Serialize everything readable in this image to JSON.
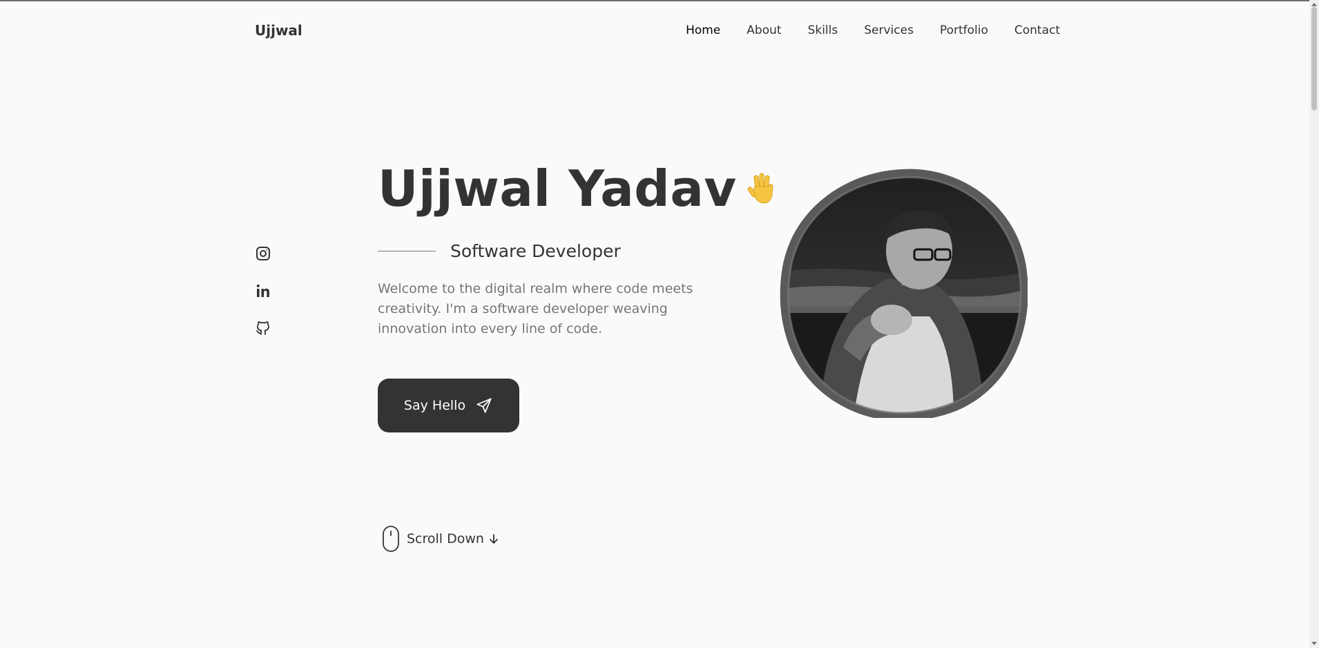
{
  "header": {
    "logo": "Ujjwal",
    "nav": [
      {
        "label": "Home",
        "active": true
      },
      {
        "label": "About"
      },
      {
        "label": "Skills"
      },
      {
        "label": "Services"
      },
      {
        "label": "Portfolio"
      },
      {
        "label": "Contact"
      }
    ]
  },
  "social": [
    "instagram-icon",
    "linkedin-icon",
    "github-icon"
  ],
  "hero": {
    "name": "Ujjwal Yadav",
    "wave_icon": "waving-hand-icon",
    "subtitle": "Software Developer",
    "description": "Welcome to the digital realm where code meets creativity. I'm a software developer weaving innovation into every line of code.",
    "cta_label": "Say Hello",
    "cta_icon": "send-icon",
    "scroll_label": "Scroll Down"
  },
  "colors": {
    "background": "#fafafa",
    "text": "#333333",
    "muted": "#757575",
    "button": "#333333",
    "wave": "#f5c542"
  }
}
